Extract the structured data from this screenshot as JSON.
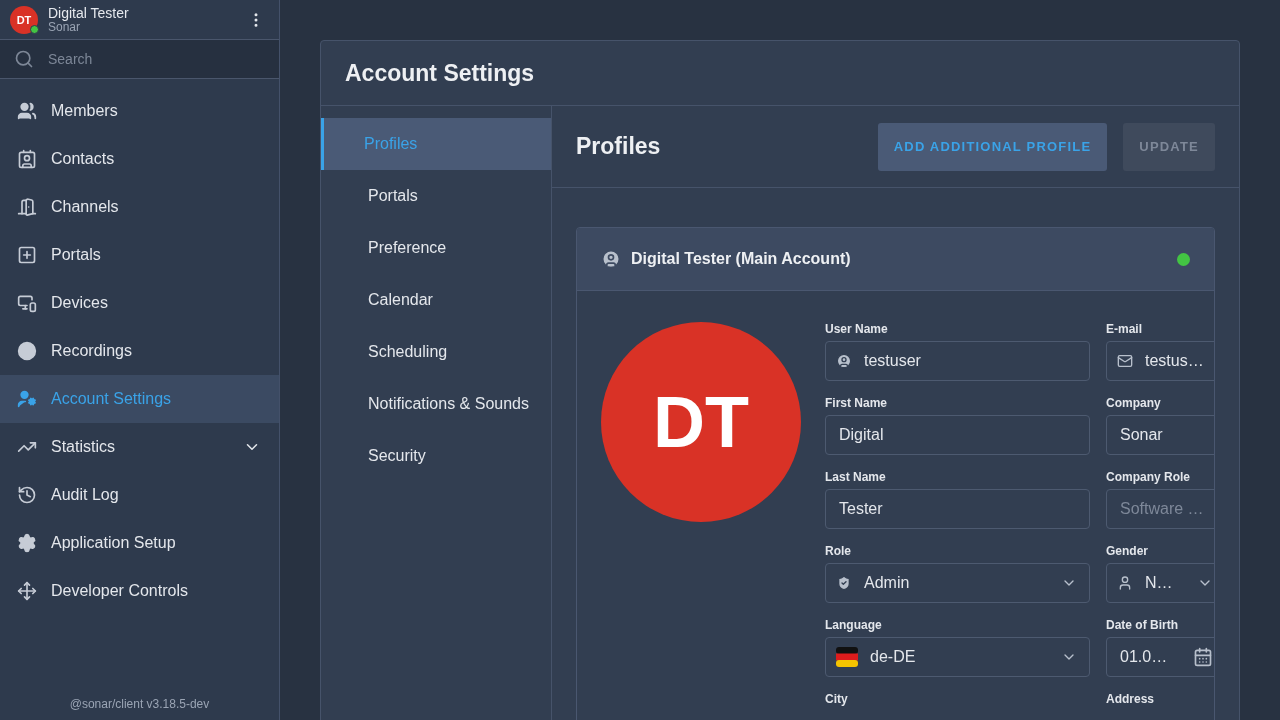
{
  "user": {
    "initials": "DT",
    "name": "Digital Tester",
    "org": "Sonar",
    "online": true
  },
  "search": {
    "placeholder": "Search"
  },
  "nav": [
    {
      "label": "Members",
      "selected": false
    },
    {
      "label": "Contacts",
      "selected": false
    },
    {
      "label": "Channels",
      "selected": false
    },
    {
      "label": "Portals",
      "selected": false
    },
    {
      "label": "Devices",
      "selected": false
    },
    {
      "label": "Recordings",
      "selected": false
    },
    {
      "label": "Account Settings",
      "selected": true
    },
    {
      "label": "Statistics",
      "selected": false,
      "expanded": false
    },
    {
      "label": "Audit Log",
      "selected": false
    },
    {
      "label": "Application Setup",
      "selected": false
    },
    {
      "label": "Developer Controls",
      "selected": false
    }
  ],
  "version": "@sonar/client v3.18.5-dev",
  "panel": {
    "title": "Account Settings",
    "tabs": [
      {
        "label": "Profiles",
        "selected": true
      },
      {
        "label": "Portals",
        "selected": false
      },
      {
        "label": "Preference",
        "selected": false
      },
      {
        "label": "Calendar",
        "selected": false
      },
      {
        "label": "Scheduling",
        "selected": false
      },
      {
        "label": "Notifications & Sounds",
        "selected": false
      },
      {
        "label": "Security",
        "selected": false
      }
    ],
    "section_title": "Profiles",
    "buttons": [
      {
        "label": "ADD ADDITIONAL PROFILE",
        "disabled": false
      },
      {
        "label": "UPDATE",
        "disabled": true
      }
    ],
    "profile": {
      "title": "Digital Tester (Main Account)",
      "online": true,
      "initials": "DT",
      "fields": [
        {
          "label": "User Name",
          "value": "testuser",
          "kind": "text"
        },
        {
          "label": "E-mail",
          "value": "testus…",
          "kind": "text"
        },
        {
          "label": "First Name",
          "value": "Digital",
          "kind": "text"
        },
        {
          "label": "Company",
          "value": "Sonar",
          "kind": "text"
        },
        {
          "label": "Last Name",
          "value": "Tester",
          "kind": "text"
        },
        {
          "label": "Company Role",
          "placeholder": "Software …",
          "kind": "text"
        },
        {
          "label": "Role",
          "value": "Admin",
          "kind": "select"
        },
        {
          "label": "Gender",
          "value": "N…",
          "kind": "select"
        },
        {
          "label": "Language",
          "value": "de-DE",
          "kind": "select"
        },
        {
          "label": "Date of Birth",
          "value": "01.0…",
          "kind": "date"
        },
        {
          "label": "City",
          "kind": "label"
        },
        {
          "label": "Address",
          "kind": "label"
        }
      ]
    }
  }
}
